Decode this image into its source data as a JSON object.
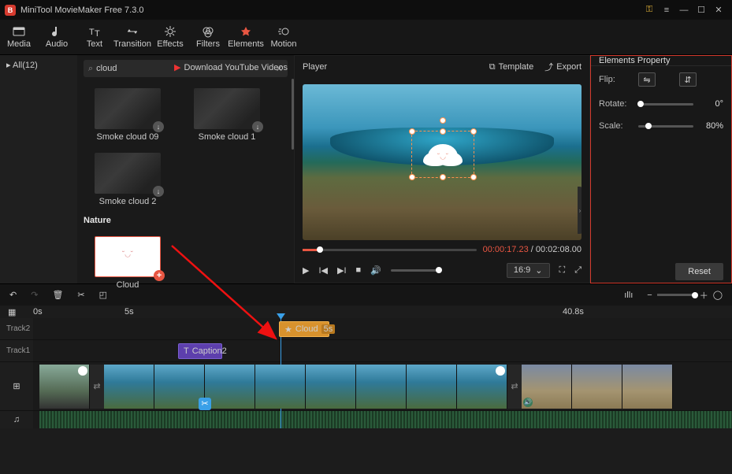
{
  "app": {
    "title": "MiniTool MovieMaker Free 7.3.0"
  },
  "toolbar": {
    "media": "Media",
    "audio": "Audio",
    "text": "Text",
    "transition": "Transition",
    "effects": "Effects",
    "filters": "Filters",
    "elements": "Elements",
    "motion": "Motion"
  },
  "sidebar": {
    "all_label": "All(12)"
  },
  "library": {
    "search_value": "cloud",
    "youtube_label": "Download YouTube Videos",
    "items": [
      {
        "label": "Smoke cloud 09"
      },
      {
        "label": "Smoke cloud 1"
      },
      {
        "label": "Smoke cloud 2"
      }
    ],
    "section_nature": "Nature",
    "cloud_label": "Cloud"
  },
  "player": {
    "title": "Player",
    "template_label": "Template",
    "export_label": "Export",
    "current_time": "00:00:17.23",
    "total_time": "00:02:08.00",
    "aspect": "16:9"
  },
  "props": {
    "title": "Elements Property",
    "flip_label": "Flip:",
    "rotate_label": "Rotate:",
    "rotate_value": "0°",
    "scale_label": "Scale:",
    "scale_value": "80%",
    "reset_label": "Reset"
  },
  "ruler": {
    "t0": "0s",
    "t1": "5s",
    "t2": "40.8s"
  },
  "timeline": {
    "track2": "Track2",
    "track1": "Track1",
    "clip_cloud_name": "Cloud",
    "clip_cloud_dur": "5s",
    "clip_caption": "Caption2"
  }
}
